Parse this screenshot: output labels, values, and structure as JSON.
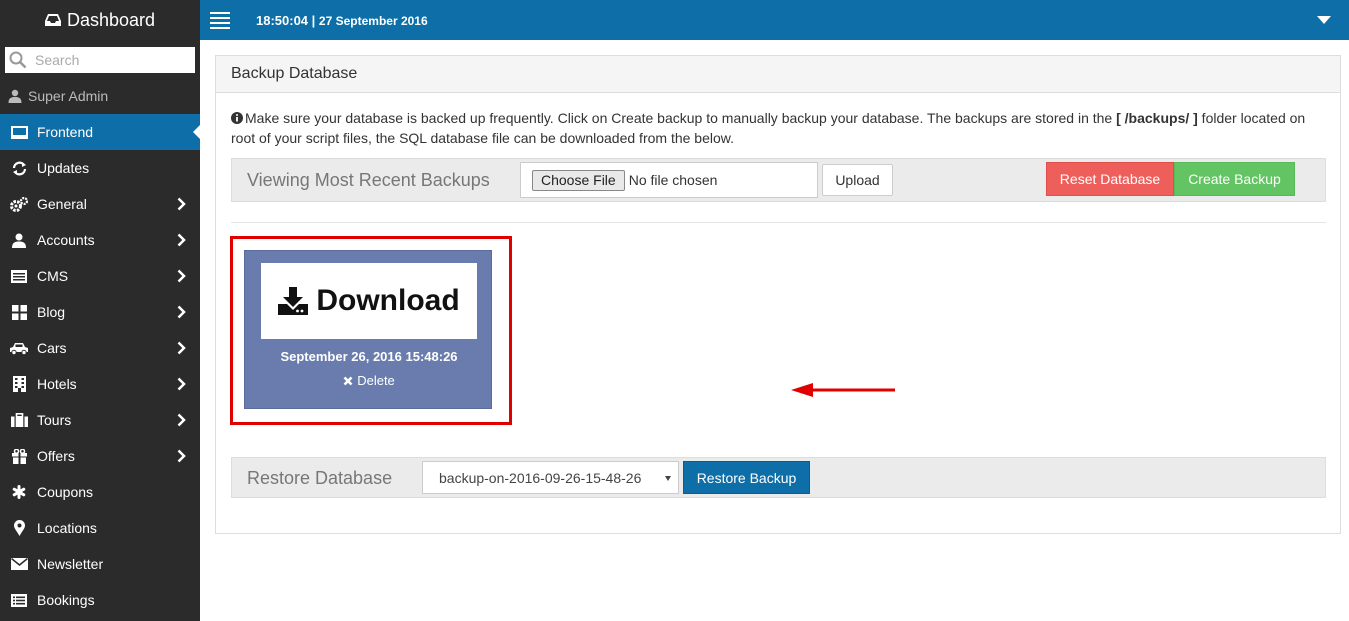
{
  "sidebar": {
    "brand": "Dashboard",
    "search_placeholder": "Search",
    "user": "Super Admin",
    "items": [
      {
        "label": "Frontend",
        "icon": "monitor-icon",
        "active": true
      },
      {
        "label": "Updates",
        "icon": "refresh-icon"
      },
      {
        "label": "General",
        "icon": "gears-icon",
        "chevron": true
      },
      {
        "label": "Accounts",
        "icon": "user-icon",
        "chevron": true
      },
      {
        "label": "CMS",
        "icon": "list-icon",
        "chevron": true
      },
      {
        "label": "Blog",
        "icon": "grid-icon",
        "chevron": true
      },
      {
        "label": "Cars",
        "icon": "car-icon",
        "chevron": true
      },
      {
        "label": "Hotels",
        "icon": "building-icon",
        "chevron": true
      },
      {
        "label": "Tours",
        "icon": "suitcase-icon",
        "chevron": true
      },
      {
        "label": "Offers",
        "icon": "gift-icon",
        "chevron": true
      },
      {
        "label": "Coupons",
        "icon": "asterisk-icon"
      },
      {
        "label": "Locations",
        "icon": "map-marker-icon"
      },
      {
        "label": "Newsletter",
        "icon": "envelope-icon"
      },
      {
        "label": "Bookings",
        "icon": "list-alt-icon"
      }
    ]
  },
  "topbar": {
    "time": "18:50:04",
    "separator": " | ",
    "date": "27 September 2016"
  },
  "panel": {
    "title": "Backup Database",
    "info_before": "Make sure your database is backed up frequently. Click on Create backup to manually backup your database. The backups are stored in the ",
    "info_bold": "[ /backups/ ]",
    "info_after": " folder located on root of your script files, the SQL database file can be downloaded from the below.",
    "viewing_label": "Viewing Most Recent Backups",
    "choose_file": "Choose File",
    "no_file": "No file chosen",
    "upload": "Upload",
    "reset": "Reset Database",
    "create": "Create Backup",
    "backup": {
      "download": "Download",
      "date": "September 26, 2016 15:48:26",
      "delete": "Delete"
    },
    "restore_label": "Restore Database",
    "restore_selected": "backup-on-2016-09-26-15-48-26",
    "restore_button": "Restore Backup"
  },
  "colors": {
    "primary": "#0e6fa8",
    "sidebar": "#2b2b2b",
    "danger": "#ee5f5b",
    "success": "#62c462",
    "card": "#6a7cad",
    "highlight": "#e00000"
  }
}
